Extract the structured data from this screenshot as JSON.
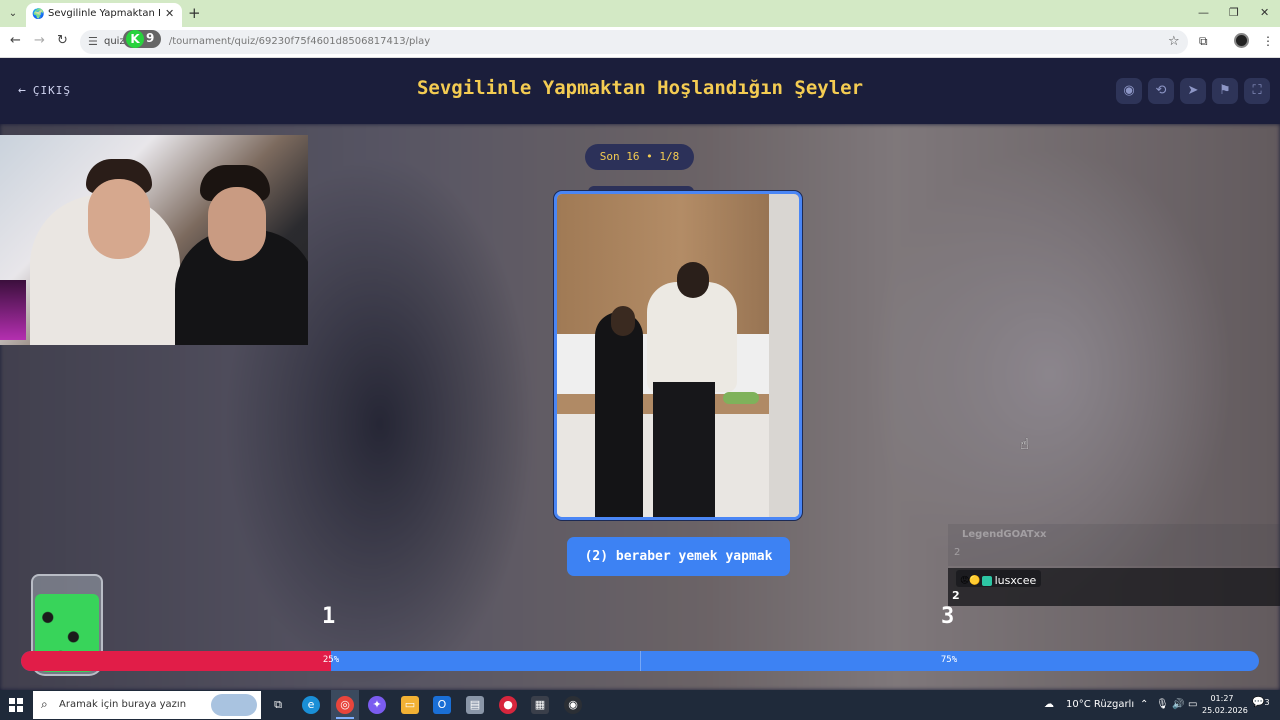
{
  "browser": {
    "tab_title": "Sevgilinle Yapmaktan Hoşlandığı",
    "url_prefix": "quize",
    "url_rest": "/tournament/quiz/69230f75f4601d8506817413/play",
    "new_tab": "+",
    "tab_close": "✕"
  },
  "k9_badge": {
    "letter": "K",
    "digit": "9"
  },
  "header": {
    "exit_label": "ÇIKIŞ",
    "title": "Sevgilinle Yapmaktan Hoşlandığın Şeyler"
  },
  "round": {
    "label": "Son 16 • 1/8"
  },
  "card": {
    "answer_label": "(2) beraber yemek yapmak"
  },
  "chat": {
    "faded_user": "LegendGOATxx",
    "faded_message": "2",
    "user": "lusxcee",
    "message": "2"
  },
  "scores": {
    "left": "1",
    "right": "3"
  },
  "vote_bar": {
    "left_fraction": 0.25,
    "left_percent_label": "25%",
    "right_percent_label": "75%",
    "left_color": "#e11d48",
    "right_color": "#3d82f3"
  },
  "taskbar": {
    "search_placeholder": "Aramak için buraya yazın",
    "weather": "10°C  Rüzgarlı",
    "time": "01:27",
    "date": "25.02.2026",
    "notifications": "3"
  },
  "icons": [
    "eye-icon",
    "shuffle-icon",
    "send-icon",
    "flag-icon",
    "fullscreen-icon"
  ]
}
